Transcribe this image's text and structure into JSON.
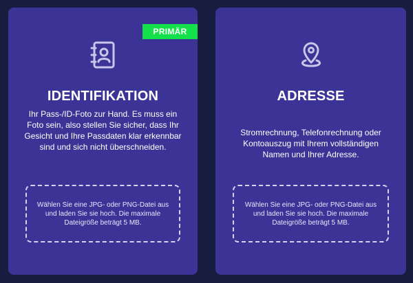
{
  "cards": [
    {
      "badge": "PRIMÄR",
      "icon": "contact-book-icon",
      "title": "IDENTIFIKATION",
      "description": "Ihr Pass-/ID-Foto zur Hand. Es muss ein Foto sein, also stellen Sie sicher, dass Ihr Gesicht und Ihre Passdaten klar erkennbar sind und sich nicht überschneiden.",
      "upload_text": "Wählen Sie eine JPG- oder PNG-Datei aus und laden Sie sie hoch. Die maximale Dateigröße beträgt 5 MB."
    },
    {
      "icon": "location-pin-icon",
      "title": "ADRESSE",
      "description": "Stromrechnung, Telefonrechnung oder Kontoauszug mit Ihrem vollständigen Namen und Ihrer Adresse.",
      "upload_text": "Wählen Sie eine JPG- oder PNG-Datei aus und laden Sie sie hoch. Die maximale Dateigröße beträgt 5 MB."
    }
  ],
  "colors": {
    "background": "#171d3e",
    "card": "#3b3496",
    "badge": "#14e04a",
    "icon": "#c9c6ea"
  }
}
